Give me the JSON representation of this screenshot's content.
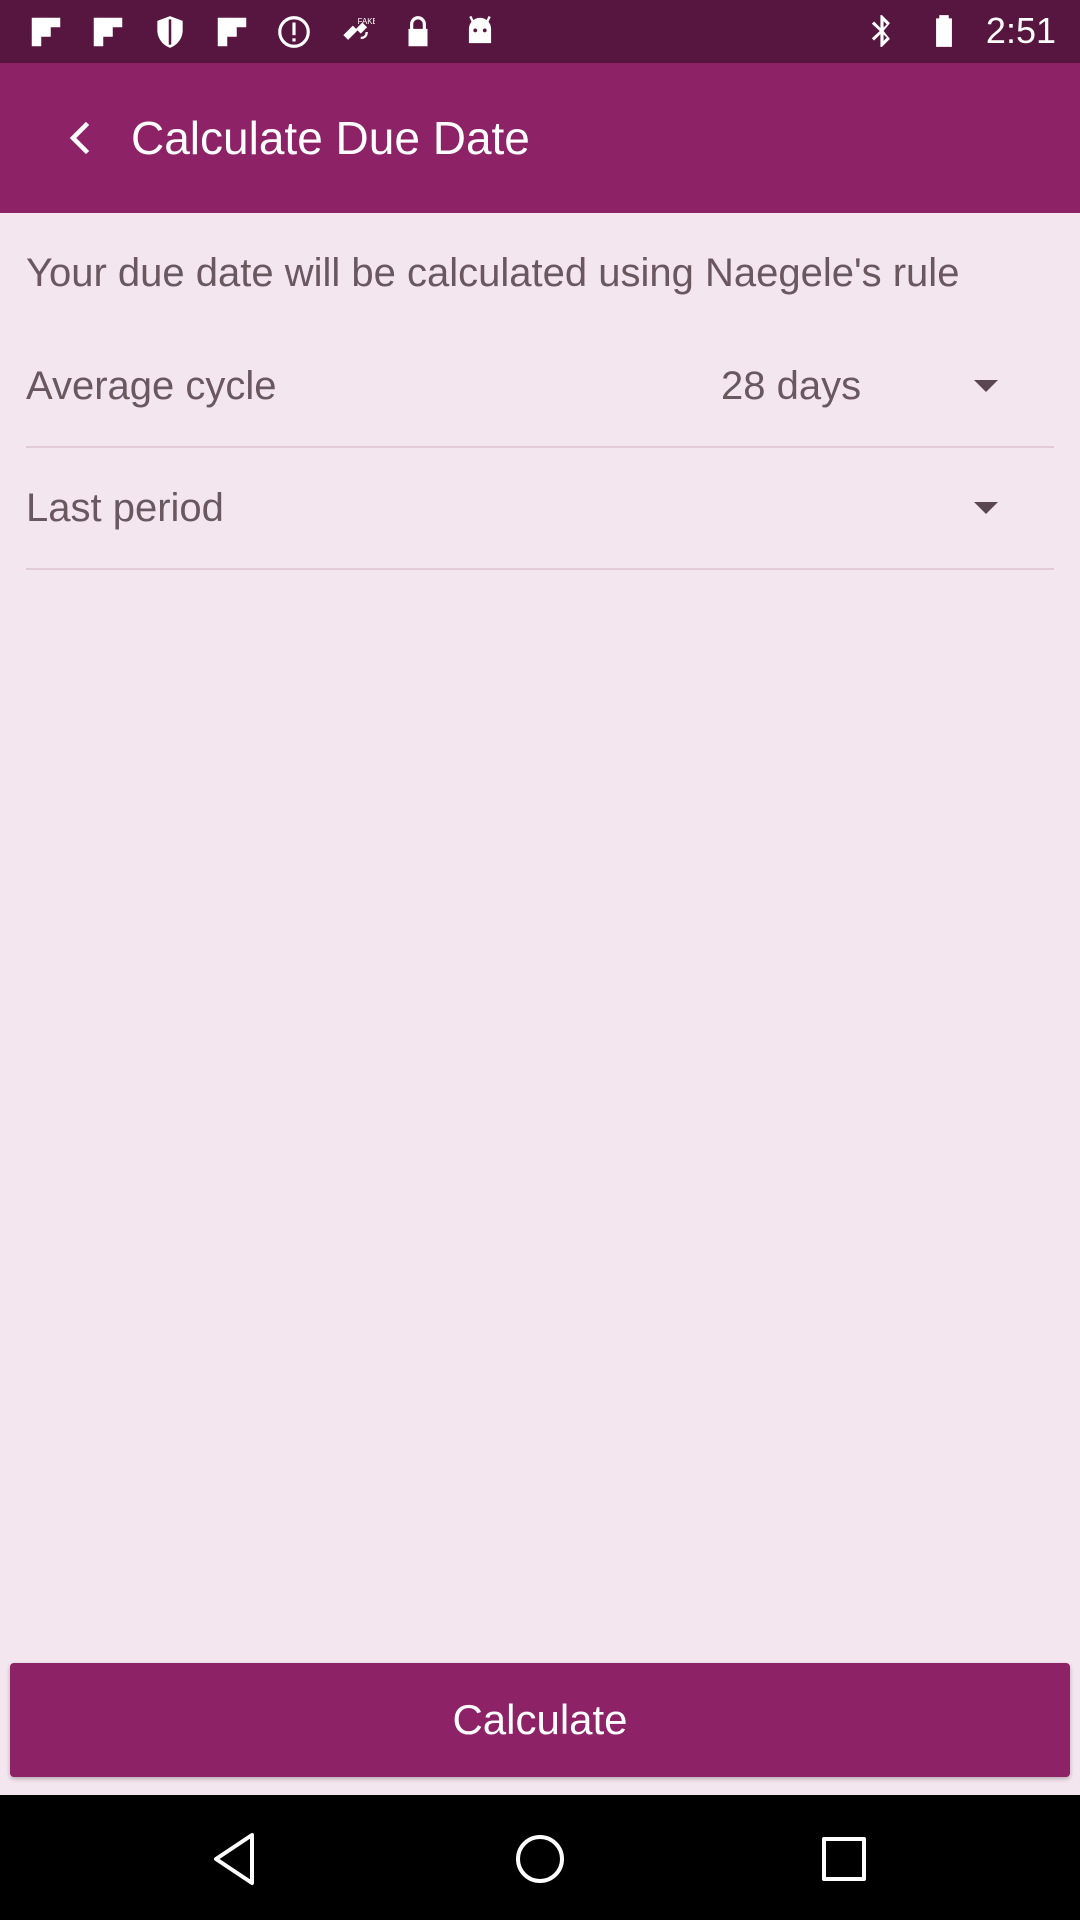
{
  "status_bar": {
    "time": "2:51",
    "left_icons": [
      "flipboard-icon",
      "flipboard-icon",
      "shield-icon",
      "flipboard-icon",
      "data-saver-icon",
      "fake-gps-icon",
      "lock-icon",
      "android-icon"
    ],
    "right_icons": [
      "bluetooth-icon",
      "battery-icon"
    ],
    "fake_badge": "FAKE"
  },
  "app_bar": {
    "title": "Calculate Due Date",
    "color": "#8e2267"
  },
  "content": {
    "intro": "Your due date will be calculated using Naegele's rule",
    "average_cycle": {
      "label": "Average cycle",
      "value": "28 days"
    },
    "last_period": {
      "label": "Last period",
      "value": ""
    }
  },
  "calculate_button": {
    "label": "Calculate"
  },
  "colors": {
    "status_bar": "#57163f",
    "accent": "#8e2267",
    "background": "#f4e6ef",
    "text": "#6a5860"
  }
}
